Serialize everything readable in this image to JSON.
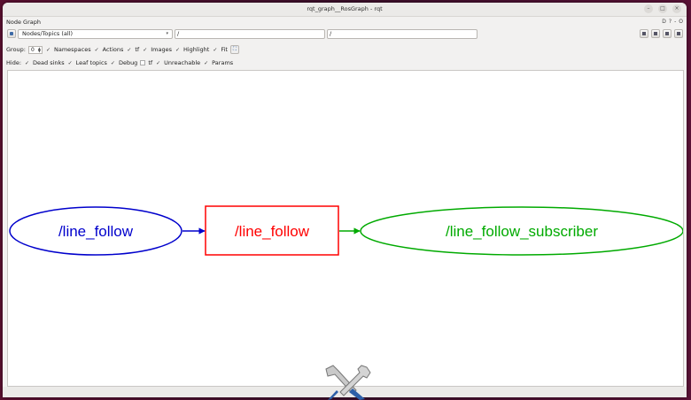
{
  "window": {
    "title": "rqt_graph__RosGraph - rqt"
  },
  "plugin": {
    "name": "Node Graph",
    "badge": "D",
    "help": "?",
    "dash": "-",
    "close": "O"
  },
  "toolbar": {
    "filter_combo": "Nodes/Topics (all)",
    "namespace_filter": "/",
    "topic_filter": "/"
  },
  "options": {
    "group_label": "Group:",
    "group_value": "0",
    "namespaces": "Namespaces",
    "actions": "Actions",
    "tf": "tf",
    "images": "Images",
    "highlight": "Highlight",
    "fit": "Fit"
  },
  "hide": {
    "label": "Hide:",
    "dead_sinks": "Dead sinks",
    "leaf_topics": "Leaf topics",
    "debug": "Debug",
    "tf": "tf",
    "unreachable": "Unreachable",
    "params": "Params"
  },
  "graph": {
    "node1": {
      "label": "/line_follow",
      "color": "#0000cc"
    },
    "topic": {
      "label": "/line_follow",
      "color": "#ff0000"
    },
    "node2": {
      "label": "/line_follow_subscriber",
      "color": "#00aa00"
    }
  },
  "icons": {
    "refresh": "refresh-icon",
    "save": "save-icon",
    "load": "load-icon",
    "tools": "tools-icon"
  }
}
